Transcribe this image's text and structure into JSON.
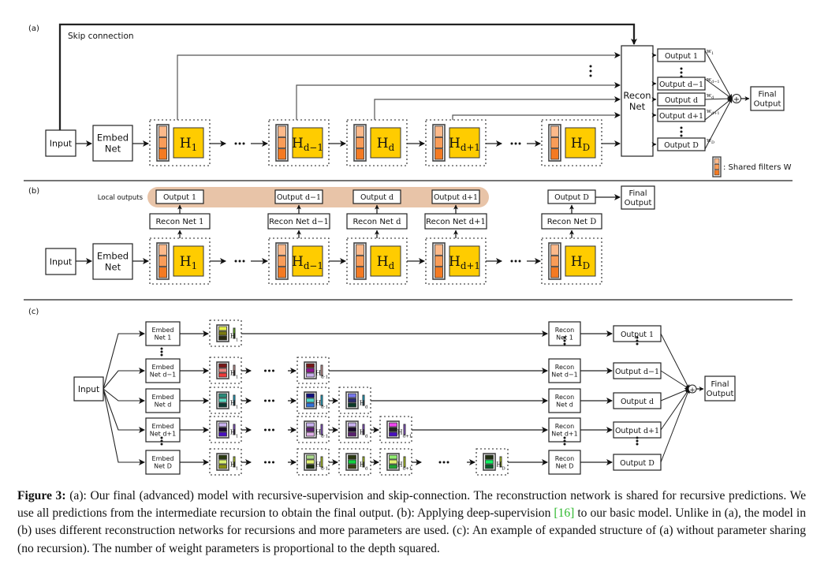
{
  "panels": {
    "a": {
      "label": "(a)",
      "skip_label": "Skip connection",
      "input": "Input",
      "embed": [
        "Embed",
        "Net"
      ],
      "blocks": [
        {
          "main": "H",
          "sub": "1"
        },
        {
          "main": "H",
          "sub": "d−1"
        },
        {
          "main": "H",
          "sub": "d"
        },
        {
          "main": "H",
          "sub": "d+1"
        },
        {
          "main": "H",
          "sub": "D"
        }
      ],
      "recon": [
        "Recon",
        "Net"
      ],
      "outputs": [
        {
          "label": "Output 1",
          "weight": "w",
          "wsub": "1"
        },
        {
          "label": "Output d−1",
          "weight": "w",
          "wsub": "d−1"
        },
        {
          "label": "Output d",
          "weight": "w",
          "wsub": "d"
        },
        {
          "label": "Output d+1",
          "weight": "w",
          "wsub": "d+1"
        },
        {
          "label": "Output D",
          "weight": "w",
          "wsub": "D"
        }
      ],
      "final": [
        "Final",
        "Output"
      ],
      "legend": ": Shared filters W",
      "ellipsis": "···"
    },
    "b": {
      "label": "(b)",
      "local_outputs": "Local outputs",
      "input": "Input",
      "embed": [
        "Embed",
        "Net"
      ],
      "columns": [
        {
          "output": "Output 1",
          "recon": "Recon Net 1",
          "main": "H",
          "sub": "1"
        },
        {
          "output": "Output d−1",
          "recon": "Recon Net d−1",
          "main": "H",
          "sub": "d−1"
        },
        {
          "output": "Output d",
          "recon": "Recon Net d",
          "main": "H",
          "sub": "d"
        },
        {
          "output": "Output d+1",
          "recon": "Recon Net d+1",
          "main": "H",
          "sub": "d+1"
        },
        {
          "output": "Output D",
          "recon": "Recon Net D",
          "main": "H",
          "sub": "D"
        }
      ],
      "final": [
        "Final",
        "Output"
      ]
    },
    "c": {
      "label": "(c)",
      "input": "Input",
      "rows": [
        {
          "embed": [
            "Embed",
            "Net 1"
          ],
          "recon": [
            "Recon",
            "Net 1"
          ],
          "output": "Output 1",
          "color": "#66cc11"
        },
        {
          "embed": [
            "Embed",
            "Net d−1"
          ],
          "recon": [
            "Recon",
            "Net d−1"
          ],
          "output": "Output d−1",
          "color": "#e8aaa8"
        },
        {
          "embed": [
            "Embed",
            "Net d"
          ],
          "recon": [
            "Recon",
            "Net d"
          ],
          "output": "Output d",
          "color": "#11c0ee"
        },
        {
          "embed": [
            "Embed",
            "Net d+1"
          ],
          "recon": [
            "Recon",
            "Net d+1"
          ],
          "output": "Output d+1",
          "color": "#9955ee"
        },
        {
          "embed": [
            "Embed",
            "Net D"
          ],
          "recon": [
            "Recon",
            "Net D"
          ],
          "output": "Output D",
          "color": "#ccee11"
        }
      ],
      "final": [
        "Final",
        "Output"
      ]
    }
  },
  "caption": {
    "lead": "Figure 3:",
    "text1": " (a): Our final (advanced) model with recursive-supervision and skip-connection. The reconstruction network is shared for recursive predictions. We use all predictions from the intermediate recursion to obtain the final output. (b): Applying deep-supervision ",
    "ref": "[16]",
    "text2": " to our basic model. Unlike in (a), the model in (b) uses different reconstruction networks for recursions and more parameters are used. (c): An example of expanded structure of (a) without parameter sharing (no recursion). The number of weight parameters is proportional to the depth squared."
  },
  "colors": {
    "h_block": "#ffcc00",
    "filter_light": "#fcb98a",
    "filter_mid": "#f99c58",
    "filter_dark": "#f47a22",
    "local_band": "#e8c4a8"
  }
}
